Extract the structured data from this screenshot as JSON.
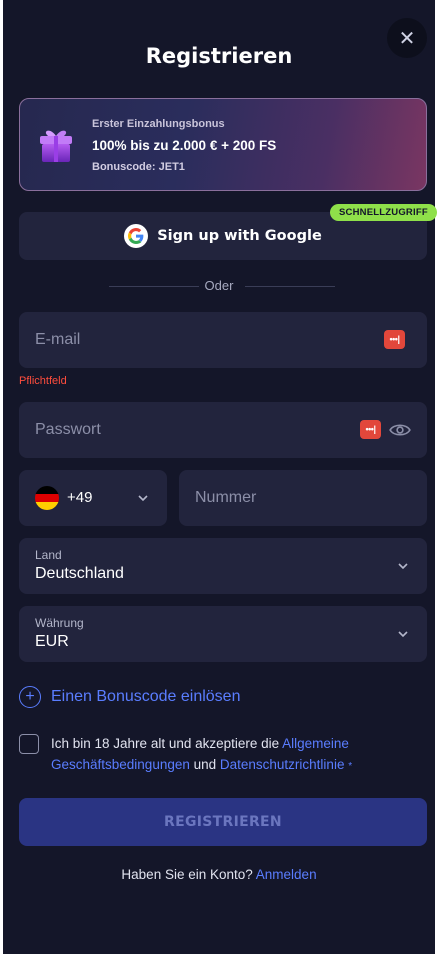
{
  "header": {
    "title": "Registrieren",
    "close_icon": "close-icon"
  },
  "bonus": {
    "title": "Erster Einzahlungsbonus",
    "offer": "100% bis zu 2.000 € + 200 FS",
    "code_label": "Bonuscode: JET1",
    "icon": "gift-icon"
  },
  "google": {
    "label": "Sign up with Google",
    "badge": "SCHNELLZUGRIFF",
    "icon": "google-icon"
  },
  "divider_text": "Oder",
  "email": {
    "placeholder": "E-mail",
    "error": "Pflichtfeld"
  },
  "password": {
    "placeholder": "Passwort",
    "badge_text": "•••|"
  },
  "phone": {
    "country_code": "+49",
    "placeholder": "Nummer",
    "flag_colors": [
      "#000000",
      "#dd0000",
      "#ffce00"
    ]
  },
  "country": {
    "label": "Land",
    "value": "Deutschland"
  },
  "currency": {
    "label": "Währung",
    "value": "EUR"
  },
  "promo": {
    "label": "Einen Bonuscode einlösen"
  },
  "terms": {
    "prefix": "Ich bin 18 Jahre alt und akzeptiere die ",
    "terms_link": "Allgemeine Geschäftsbedingungen",
    "middle": " und ",
    "privacy_link": "Datenschutzrichtlinie",
    "required_mark": "*"
  },
  "submit": {
    "label": "REGISTRIEREN"
  },
  "login": {
    "prompt": "Haben Sie ein Konto? ",
    "link": "Anmelden"
  },
  "colors": {
    "background": "#141629",
    "field": "#22243d",
    "accent": "#5a7dff",
    "badge": "#8fe04a",
    "error": "#ff4d3d",
    "button": "#2a3483"
  }
}
